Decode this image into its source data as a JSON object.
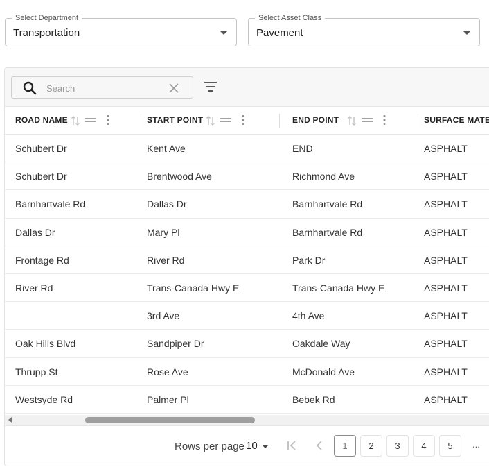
{
  "filters": {
    "department": {
      "legend": "Select Department",
      "value": "Transportation"
    },
    "asset_class": {
      "legend": "Select Asset Class",
      "value": "Pavement"
    }
  },
  "toolbar": {
    "search_placeholder": "Search",
    "icons": [
      "search-icon",
      "clear-icon",
      "filter-icon"
    ]
  },
  "table": {
    "columns": [
      {
        "label": "ROAD NAME"
      },
      {
        "label": "START POINT"
      },
      {
        "label": "END POINT"
      },
      {
        "label": "SURFACE MATERIAL"
      }
    ],
    "rows": [
      [
        "Schubert Dr",
        "Kent Ave",
        "END",
        "ASPHALT"
      ],
      [
        "Schubert Dr",
        "Brentwood Ave",
        "Richmond Ave",
        "ASPHALT"
      ],
      [
        "Barnhartvale Rd",
        "Dallas Dr",
        "Barnhartvale Rd",
        "ASPHALT"
      ],
      [
        "Dallas Dr",
        "Mary Pl",
        "Barnhartvale Rd",
        "ASPHALT"
      ],
      [
        "Frontage Rd",
        "River Rd",
        "Park Dr",
        "ASPHALT"
      ],
      [
        "River Rd",
        "Trans-Canada Hwy E",
        "Trans-Canada Hwy E",
        "ASPHALT"
      ],
      [
        "",
        "3rd Ave",
        "4th Ave",
        "ASPHALT"
      ],
      [
        "Oak Hills Blvd",
        "Sandpiper Dr",
        "Oakdale Way",
        "ASPHALT"
      ],
      [
        "Thrupp St",
        "Rose Ave",
        "McDonald Ave",
        "ASPHALT"
      ],
      [
        "Westsyde Rd",
        "Palmer Pl",
        "Bebek Rd",
        "ASPHALT"
      ]
    ]
  },
  "pagination": {
    "rows_per_page_label": "Rows per page",
    "rows_per_page_value": "10",
    "current_page": "1",
    "pages": [
      "1",
      "2",
      "3",
      "4",
      "5"
    ],
    "ellipsis": "..."
  },
  "colors": {
    "toolbar_bg": "#f7f7f7",
    "scroll_thumb": "#9e9e9e",
    "border": "#c4c4c4"
  }
}
